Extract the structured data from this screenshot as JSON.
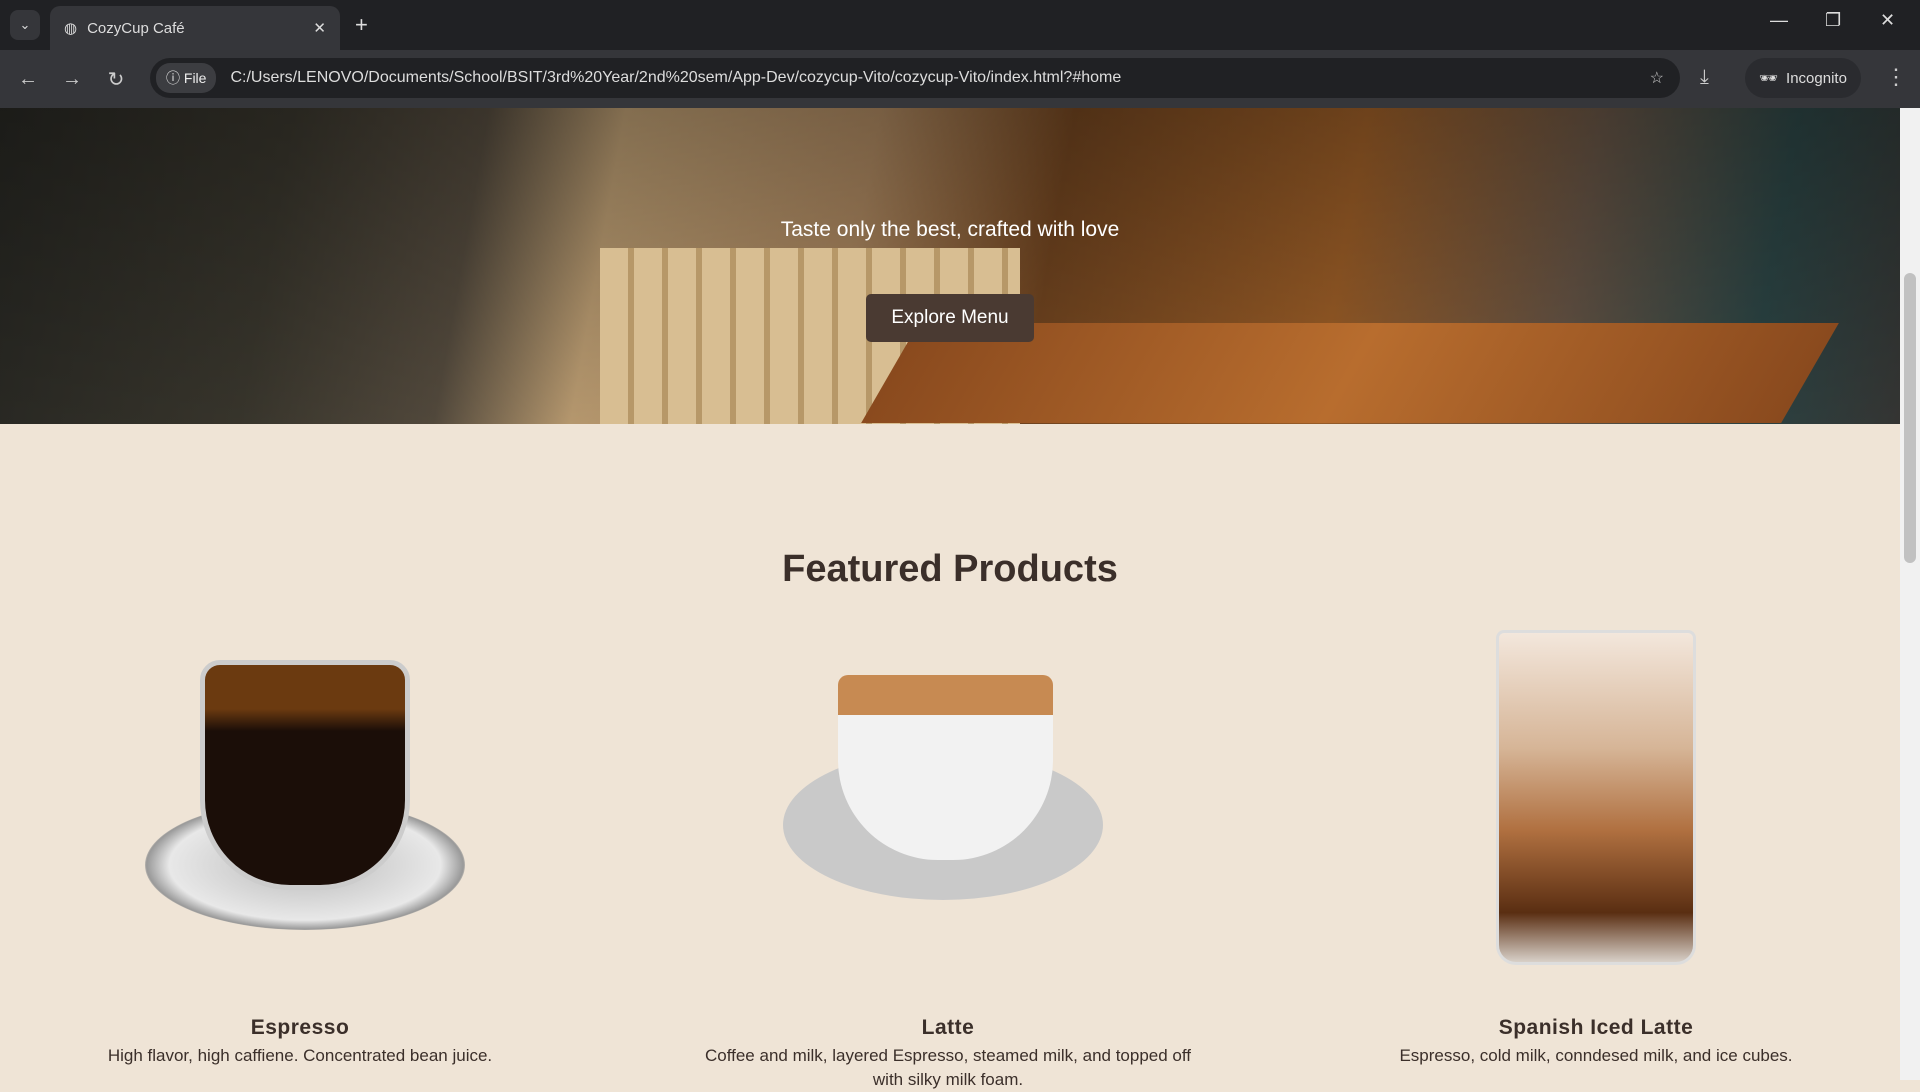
{
  "browser": {
    "tab_title": "CozyCup Café",
    "url_chip": "File",
    "url": "C:/Users/LENOVO/Documents/School/BSIT/3rd%20Year/2nd%20sem/App-Dev/cozycup-Vito/cozycup-Vito/index.html?#home",
    "incognito_label": "Incognito"
  },
  "hero": {
    "tagline": "Taste only the best, crafted with love",
    "button": "Explore Menu"
  },
  "featured": {
    "title": "Featured Products",
    "products": [
      {
        "name": "Espresso",
        "desc": "High flavor, high caffiene. Concentrated bean juice."
      },
      {
        "name": "Latte",
        "desc": "Coffee and milk, layered Espresso, steamed milk, and topped off with silky milk foam."
      },
      {
        "name": "Spanish Iced Latte",
        "desc": "Espresso, cold milk, conndesed milk, and ice cubes."
      }
    ]
  }
}
